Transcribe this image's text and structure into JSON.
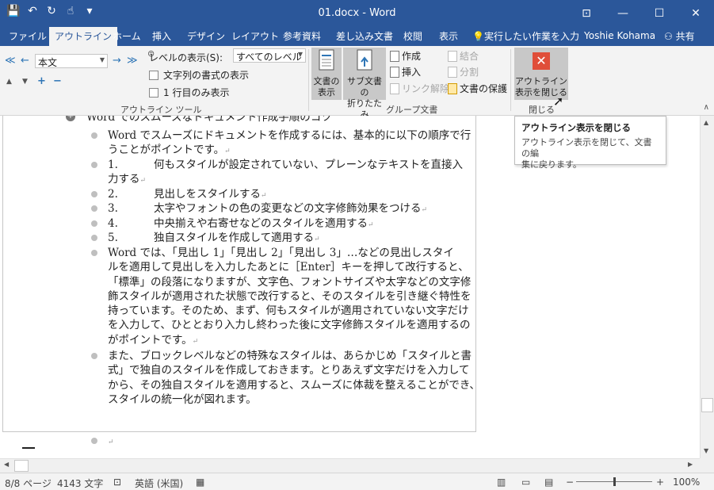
{
  "window": {
    "title": "01.docx - Word",
    "minimize": "—",
    "maximize": "☐",
    "close": "✕",
    "ribbon_display": "⊡"
  },
  "qat": {
    "save": "💾",
    "undo": "↶",
    "redo": "↻",
    "touch": "☝",
    "customize": "▾"
  },
  "tabs": {
    "file": "ファイル",
    "outline": "アウトライン",
    "home": "ホーム",
    "insert": "挿入",
    "design": "デザイン",
    "layout": "レイアウト",
    "references": "参考資料",
    "mailings": "差し込み文書",
    "review": "校閲",
    "view": "表示",
    "tell_me": "実行したい作業を入力してください",
    "user": "Yoshie Kohama",
    "share": "共有"
  },
  "ribbon": {
    "outline_tools": {
      "style_value": "本文",
      "show_level_label": "レベルの表示(S):",
      "show_level_value": "すべてのレベル",
      "show_text_formatting": "文字列の書式の表示",
      "show_first_line_only": "1 行目のみ表示",
      "group_label": "アウトライン ツール"
    },
    "master_document": {
      "show_document_l1": "文書の",
      "show_document_l2": "表示",
      "collapse_sub_l1": "サブ文書の",
      "collapse_sub_l2": "折りたたみ",
      "create": "作成",
      "insert": "挿入",
      "unlink": "リンク解除",
      "merge": "結合",
      "split": "分割",
      "lock_document": "文書の保護",
      "group_label": "グループ文書"
    },
    "close": {
      "button_l1": "アウトライン",
      "button_l2": "表示を閉じる",
      "group_label": "閉じる"
    }
  },
  "tooltip": {
    "title": "アウトライン表示を閉じる",
    "body_l1": "アウトライン表示を閉じて、文書の編",
    "body_l2": "集に戻ります。"
  },
  "document": {
    "heading": "Word でのスムーズなドキュメント作成手順のコツ",
    "p1_l1": "Word でスムーズにドキュメントを作成するには、基本的に以下の順序で行",
    "p1_l2": "うことがポイントです。",
    "n1": "1.",
    "s1_l1": "何もスタイルが設定されていない、プレーンなテキストを直接入",
    "s1_l2": "力する",
    "n2": "2.",
    "s2": "見出しをスタイルする",
    "n3": "3.",
    "s3": "太字やフォントの色の変更などの文字修飾効果をつける",
    "n4": "4.",
    "s4": "中央揃えや右寄せなどのスタイルを適用する",
    "n5": "5.",
    "s5": "独自スタイルを作成して適用する",
    "p2_l1": "Word では、「見出し 1」「見出し 2」「見出し 3」…などの見出しスタイ",
    "p2_l2": "ルを適用して見出しを入力したあとに［Enter］キーを押して改行すると、",
    "p2_l3": "「標準」の段落になりますが、文字色、フォントサイズや太字などの文字修",
    "p2_l4": "飾スタイルが適用された状態で改行すると、そのスタイルを引き継ぐ特性を",
    "p2_l5": "持っています。そのため、まず、何もスタイルが適用されていない文字だけ",
    "p2_l6": "を入力して、ひととおり入力し終わった後に文字修飾スタイルを適用するの",
    "p2_l7": "がポイントです。",
    "p3_l1": "また、ブロックレベルなどの特殊なスタイルは、あらかじめ「スタイルと書",
    "p3_l2": "式」で独自のスタイルを作成しておきます。とりあえず文字だけを入力して",
    "p3_l3": "から、その独自スタイルを適用すると、スムーズに体裁を整えることができ、",
    "p3_l4": "スタイルの統一化が図れます。",
    "para_mark": "↵"
  },
  "statusbar": {
    "page": "8/8 ページ",
    "words": "4143 文字",
    "language": "英語 (米国)",
    "zoom": "100%"
  },
  "colors": {
    "accent": "#2b579a",
    "close_icon": "#e04e39"
  }
}
